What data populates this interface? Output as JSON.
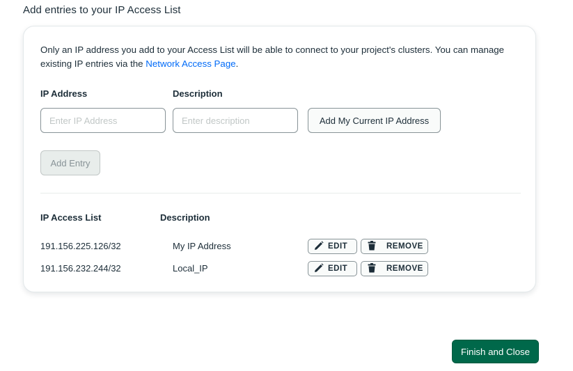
{
  "section_title": "Add entries to your IP Access List",
  "intro": {
    "text": "Only an IP address you add to your Access List will be able to connect to your project's clusters. You can manage existing IP entries via the ",
    "link": "Network Access Page",
    "suffix": "."
  },
  "form": {
    "ip_label": "IP Address",
    "ip_placeholder": "Enter IP Address",
    "ip_value": "",
    "desc_label": "Description",
    "desc_placeholder": "Enter description",
    "desc_value": "",
    "current_ip_button": "Add My Current IP Address",
    "add_entry_button": "Add Entry"
  },
  "access_list": {
    "col_ip": "IP Access List",
    "col_desc": "Description",
    "edit_label": "EDIT",
    "remove_label": "REMOVE",
    "rows": [
      {
        "ip": "191.156.225.126/32",
        "description": "My IP Address"
      },
      {
        "ip": "191.156.232.244/32",
        "description": "Local_IP"
      }
    ]
  },
  "footer": {
    "finish_button": "Finish and Close"
  },
  "colors": {
    "primary": "#00684a",
    "link": "#016bf8",
    "text": "#1c2d38",
    "border": "#889397"
  },
  "icons": {
    "edit": "pencil-icon",
    "remove": "trash-icon"
  }
}
